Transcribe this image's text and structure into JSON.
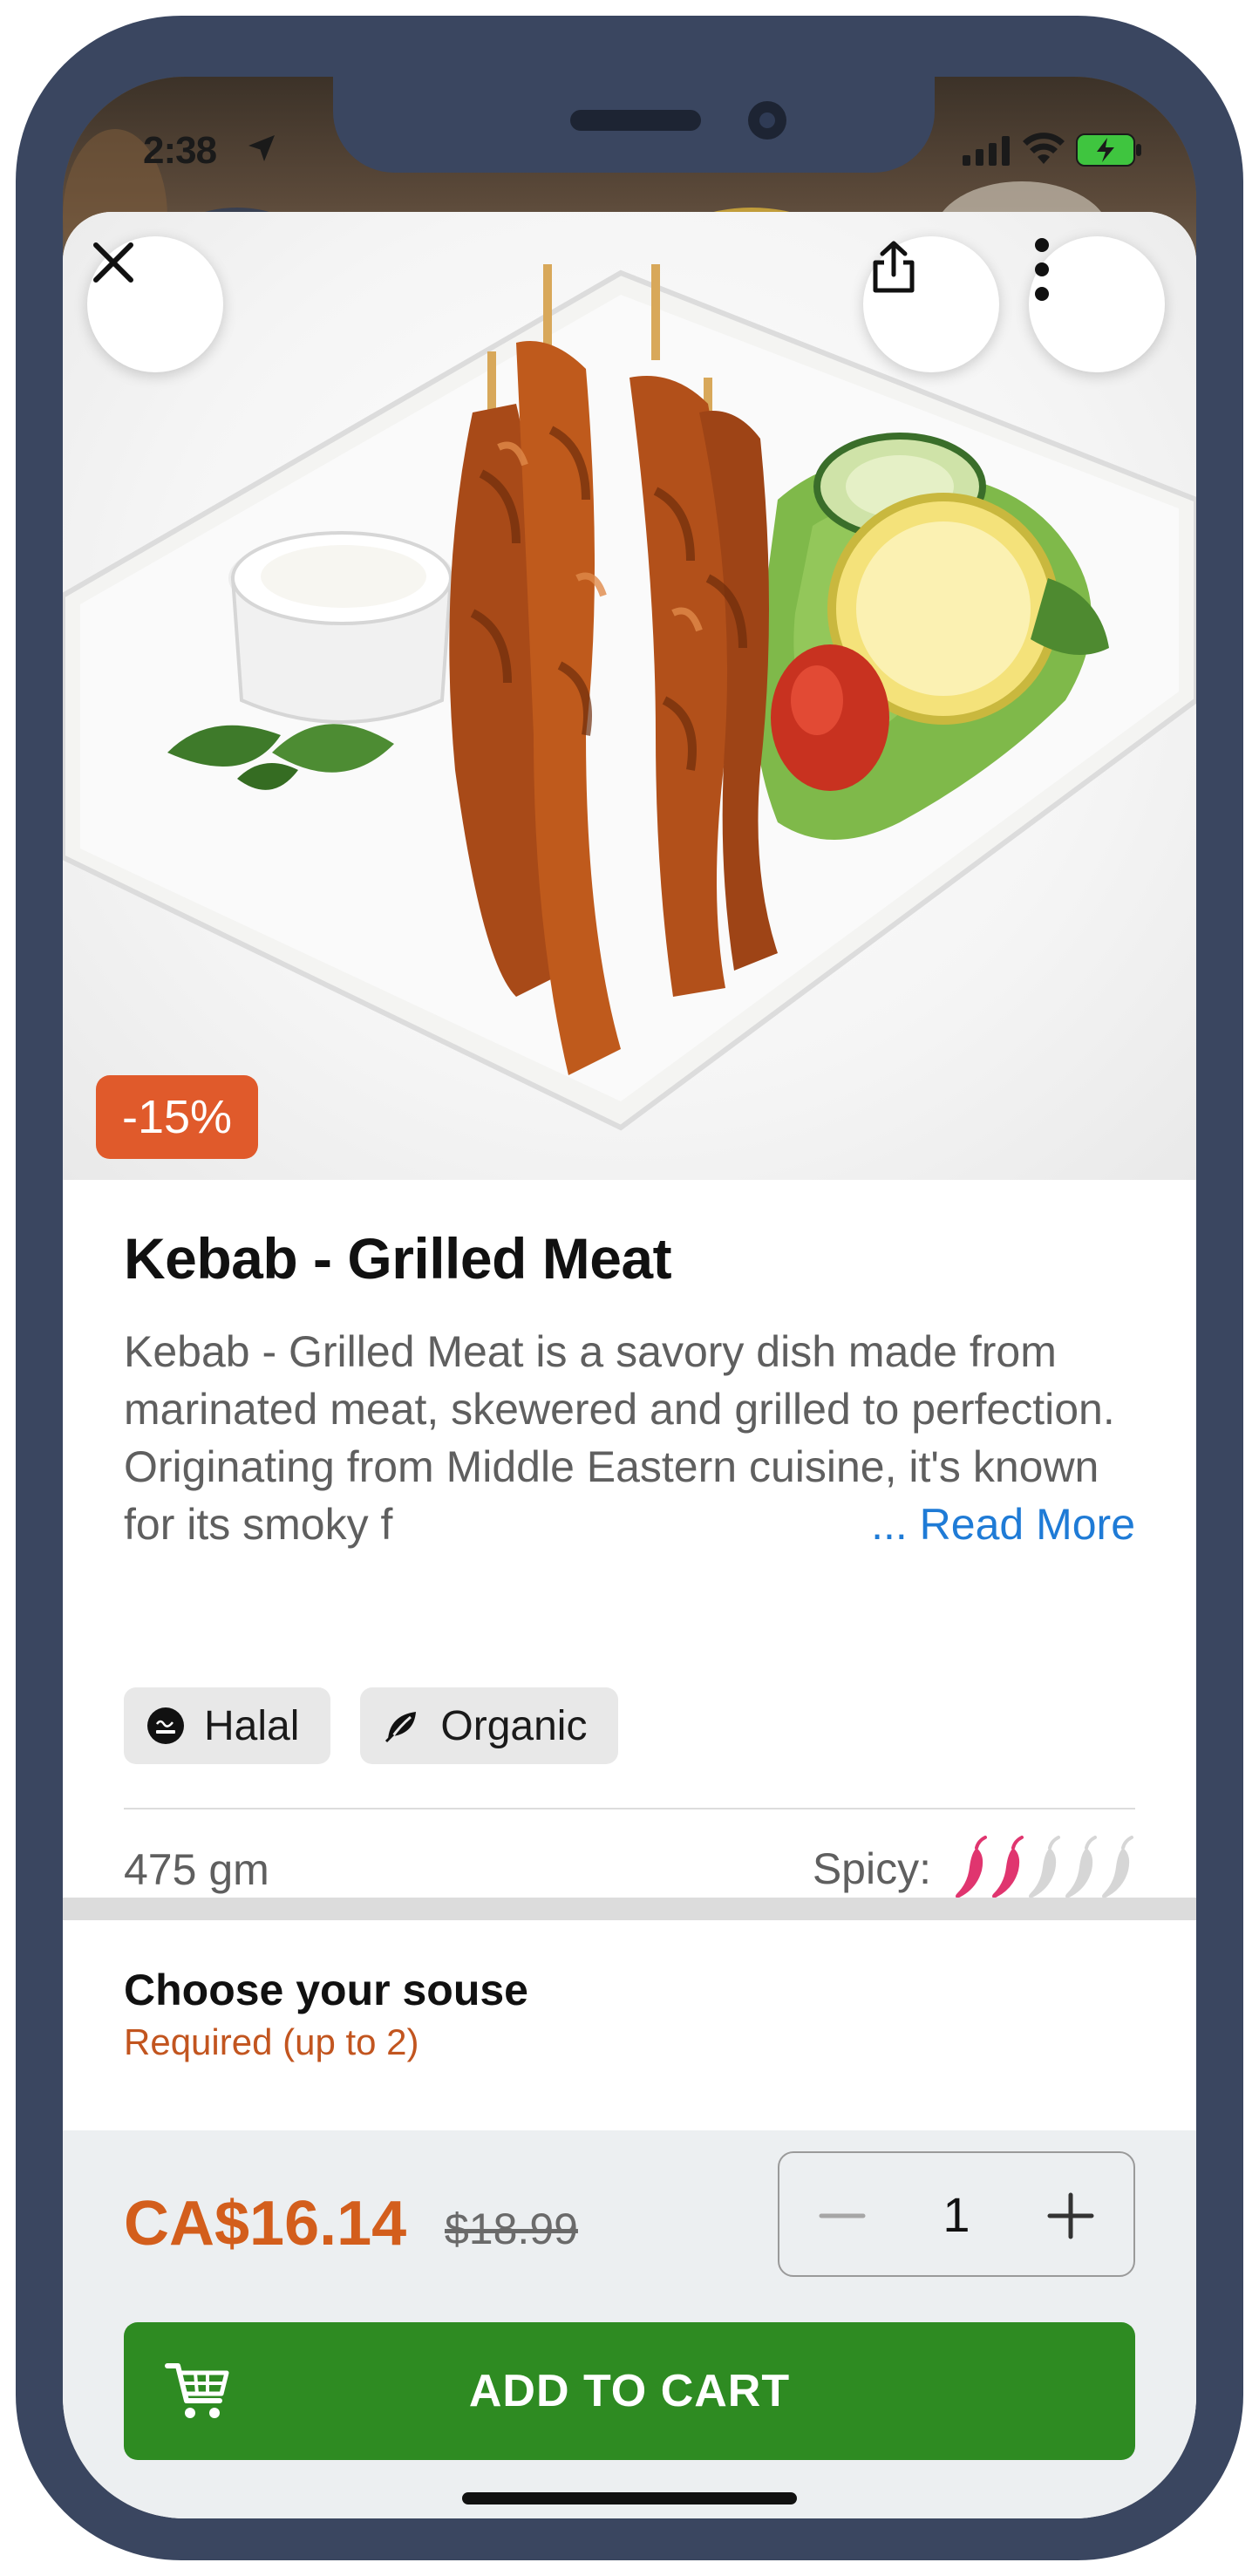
{
  "status_bar": {
    "time": "2:38"
  },
  "product": {
    "discount_badge": "-15%",
    "title": "Kebab - Grilled Meat",
    "description": "Kebab - Grilled Meat is a savory dish made from marinated meat, skewered and grilled to perfection. Originating from Middle Eastern cuisine, it's known for its smoky f",
    "read_more": "... Read More",
    "tags": [
      {
        "label": "Halal",
        "icon": "halal-icon"
      },
      {
        "label": "Organic",
        "icon": "leaf-icon"
      }
    ],
    "weight": "475 gm",
    "spicy_label": "Spicy:",
    "spicy_level": 2,
    "spicy_max": 5
  },
  "options": {
    "title": "Choose your souse",
    "subtitle": "Required (up to 2)"
  },
  "checkout": {
    "price": "CA$16.14",
    "old_price": "$18.99",
    "quantity": "1",
    "add_to_cart": "ADD TO CART"
  },
  "colors": {
    "accent_orange": "#d35e1c",
    "discount_bg": "#e05a2b",
    "link_blue": "#1f7bd6",
    "cart_green": "#2e8b22",
    "pepper_active": "#e0356f",
    "pepper_inactive": "#d6d6d6",
    "frame": "#3a4660"
  }
}
